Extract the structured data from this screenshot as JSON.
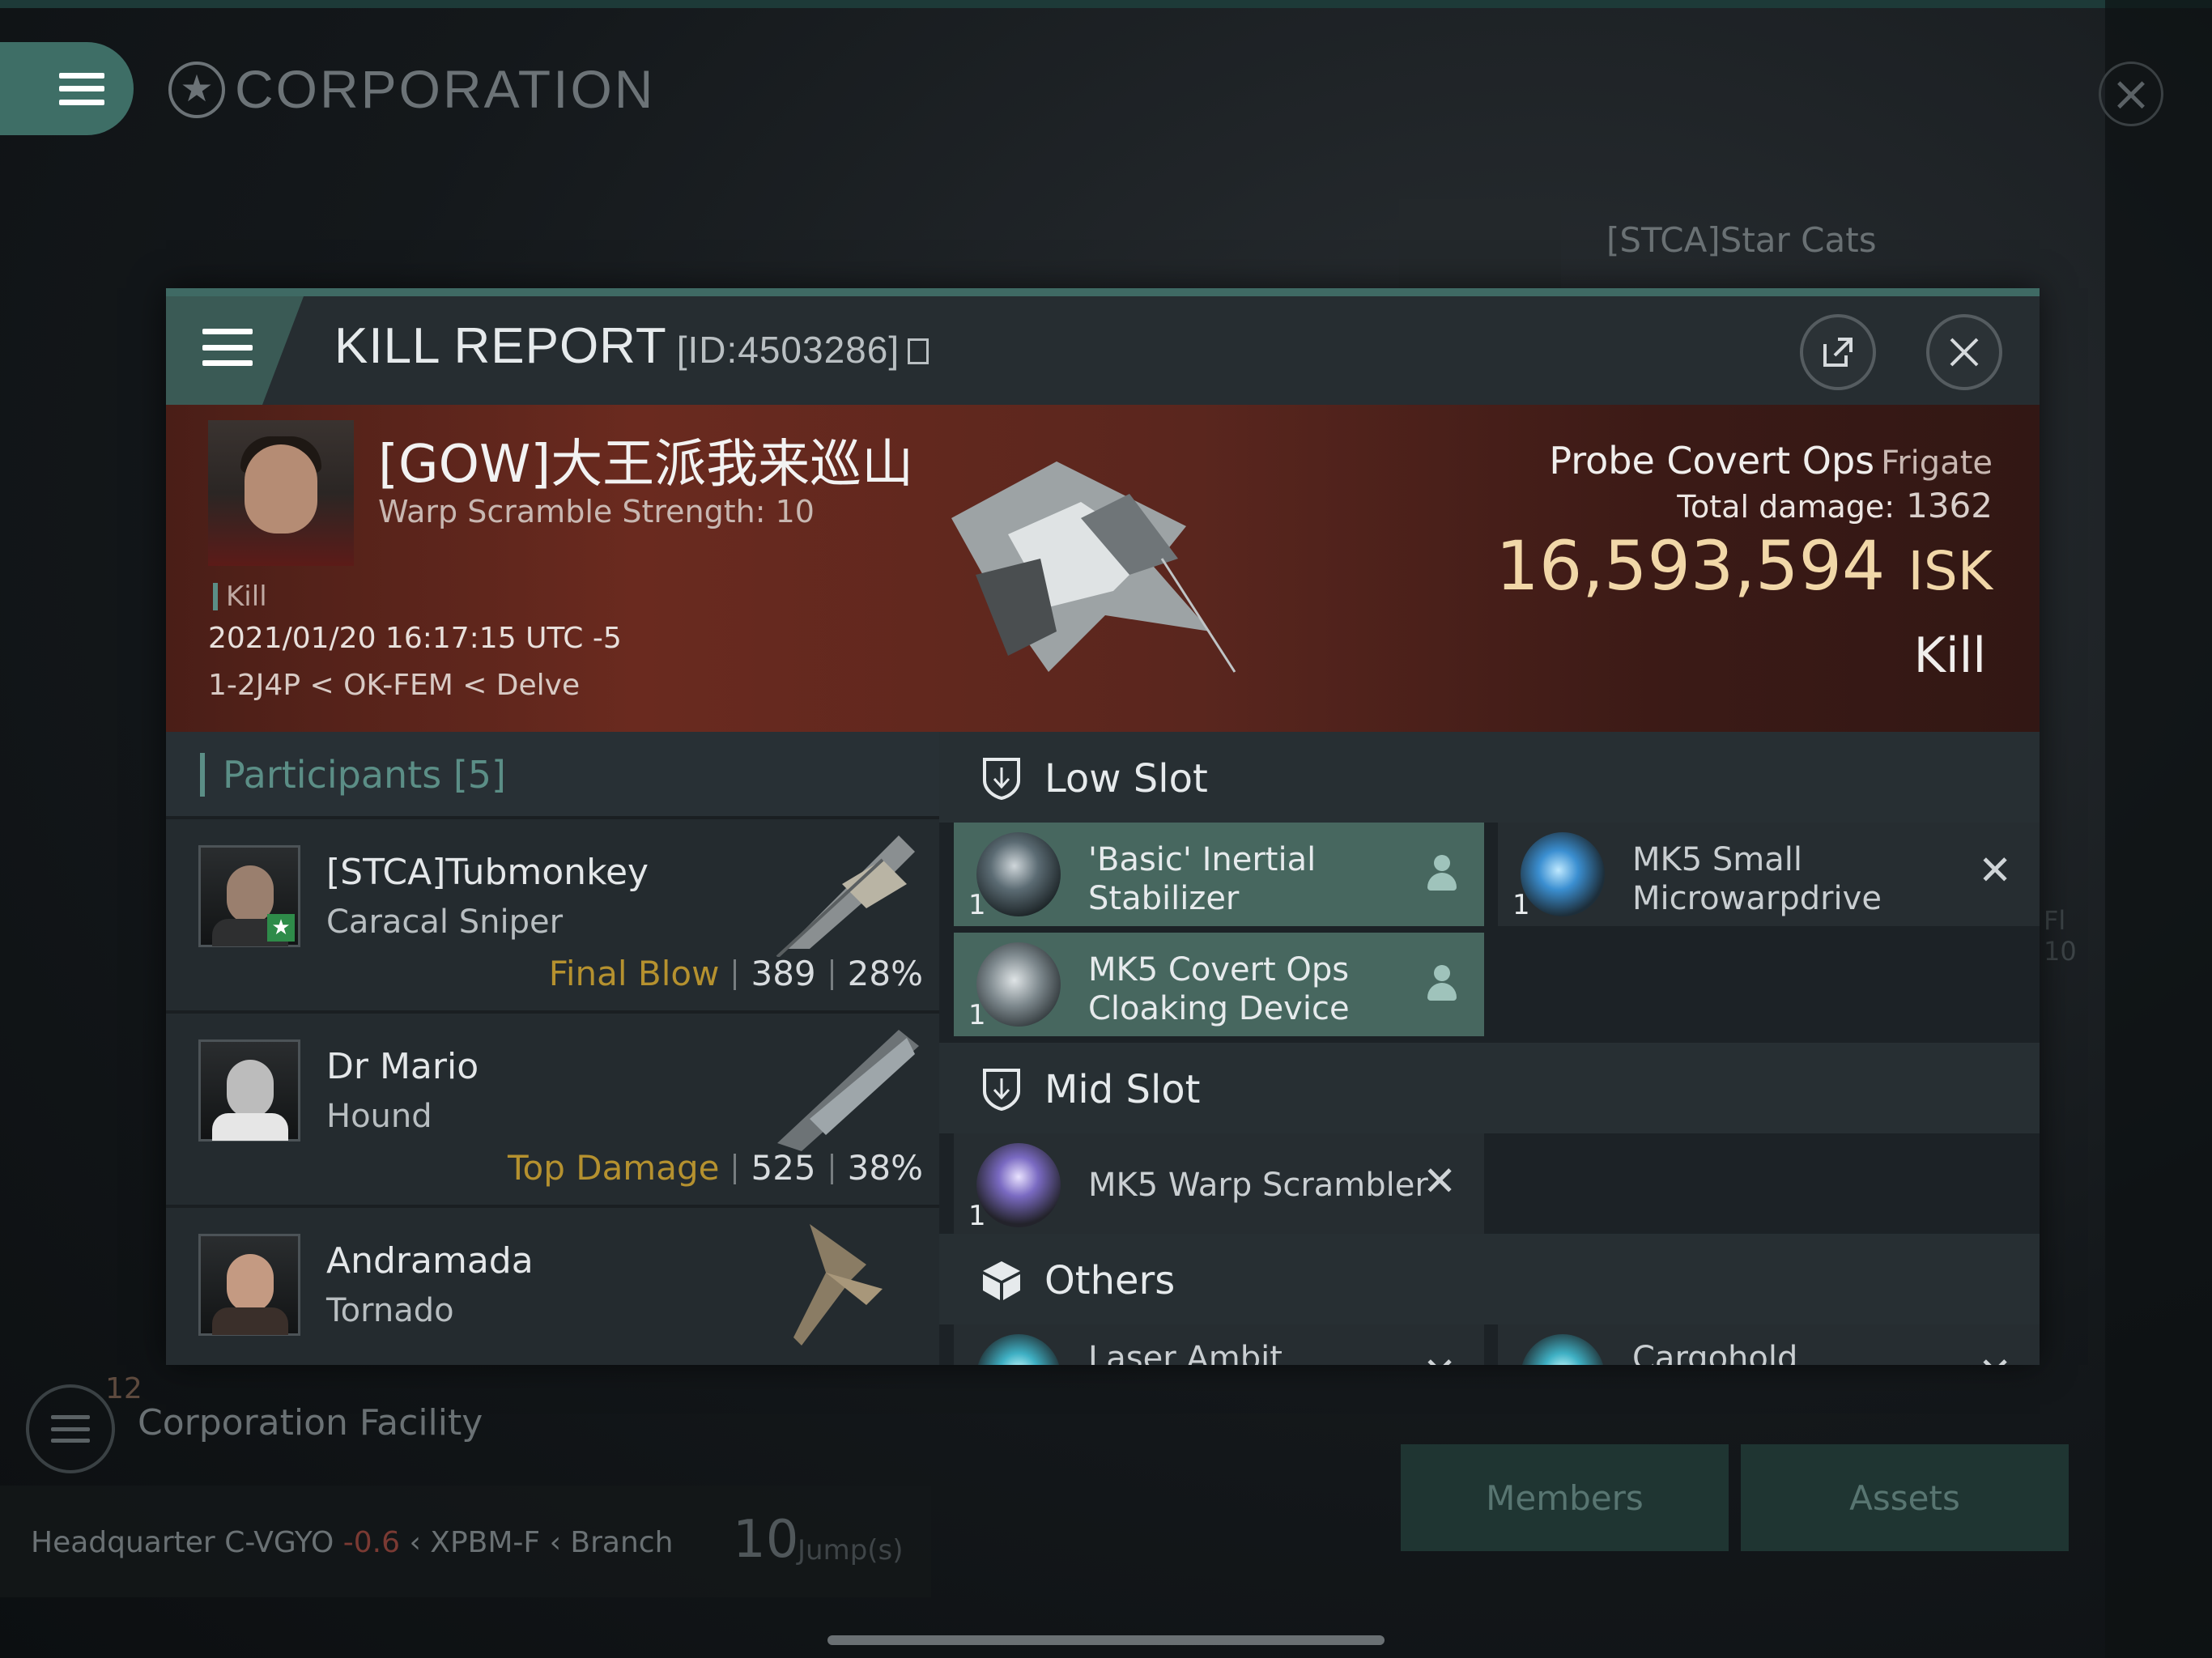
{
  "background": {
    "title": "CORPORATION",
    "corp_name": "[STCA]Star Cats",
    "facility_label": "Corporation Facility",
    "facility_count": "12",
    "hq": {
      "label": "Headquarter",
      "system": "C-VGYO",
      "security": "-0.6",
      "region1": "XPBM-F",
      "branch": "Branch"
    },
    "jumps": "10",
    "jumps_unit": "Jump(s)",
    "members_button": "Members",
    "assets_button": "Assets",
    "side_text_1": "Fl",
    "side_text_2": "10"
  },
  "kill_report": {
    "title": "KILL REPORT",
    "id": "[ID:4503286]",
    "victim": {
      "name": "[GOW]大王派我来巡山",
      "detail": "Warp Scramble Strength: 10",
      "tag": "Kill",
      "timestamp": "2021/01/20 16:17:15 UTC -5",
      "location": "1-2J4P < OK-FEM < Delve"
    },
    "ship": {
      "name": "Probe Covert Ops",
      "class": "Frigate"
    },
    "total_damage_label": "Total damage:",
    "total_damage": "1362",
    "isk_value": "16,593,594",
    "isk_unit": "ISK",
    "result": "Kill"
  },
  "participants": {
    "label": "Participants",
    "count": "[5]",
    "rows": [
      {
        "name": "[STCA]Tubmonkey",
        "ship": "Caracal Sniper",
        "role": "Final Blow",
        "damage": "389",
        "percent": "28%"
      },
      {
        "name": "Dr Mario",
        "ship": "Hound",
        "role": "Top Damage",
        "damage": "525",
        "percent": "38%"
      },
      {
        "name": "Andramada",
        "ship": "Tornado",
        "role": "",
        "damage": "",
        "percent": ""
      }
    ]
  },
  "fittings": {
    "low_slot": {
      "label": "Low Slot",
      "left": [
        {
          "qty": "1",
          "name1": "'Basic' Inertial",
          "name2": "Stabilizer",
          "state": "dropped"
        },
        {
          "qty": "1",
          "name1": "MK5 Covert Ops",
          "name2": "Cloaking Device",
          "state": "dropped"
        }
      ],
      "right": [
        {
          "qty": "1",
          "name1": "MK5 Small",
          "name2": "Microwarpdrive",
          "state": "destroyed"
        }
      ]
    },
    "mid_slot": {
      "label": "Mid Slot",
      "left": [
        {
          "qty": "1",
          "name1": "MK5 Warp Scrambler",
          "state": "destroyed"
        }
      ]
    },
    "others": {
      "label": "Others",
      "left": [
        {
          "name1": "Laser Ambit",
          "state": "destroyed"
        }
      ],
      "right": [
        {
          "name1": "Cargohold",
          "state": "destroyed"
        }
      ]
    }
  },
  "icons": [
    "hamburger-icon",
    "star-icon",
    "close-icon",
    "share-icon",
    "copy-icon",
    "shield-icon",
    "cube-icon",
    "person-icon"
  ]
}
